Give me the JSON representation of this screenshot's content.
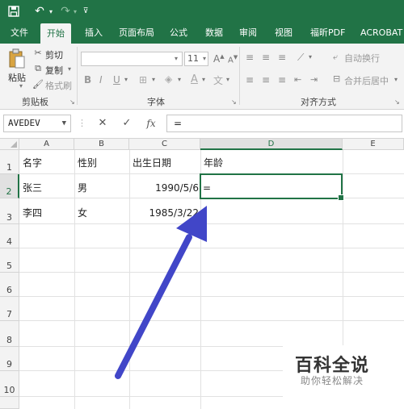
{
  "quick_access": {
    "save_icon": "save-icon",
    "undo_icon": "undo-icon",
    "redo_icon": "redo-icon",
    "customize_icon": "customize-qa-icon"
  },
  "ribbon_tabs": [
    "文件",
    "开始",
    "插入",
    "页面布局",
    "公式",
    "数据",
    "审阅",
    "视图",
    "福昕PDF",
    "ACROBAT"
  ],
  "active_tab": "开始",
  "clipboard": {
    "paste_label": "粘贴",
    "cut_label": "剪切",
    "copy_label": "复制",
    "format_painter_label": "格式刷",
    "group_label": "剪贴板"
  },
  "font_group": {
    "font_size": "11",
    "bold": "B",
    "italic": "I",
    "underline": "U",
    "group_label": "字体"
  },
  "alignment_group": {
    "wrap_text_label": "自动换行",
    "merge_center_label": "合并后居中",
    "group_label": "对齐方式"
  },
  "formula_bar": {
    "name_box": "AVEDEV",
    "cancel_symbol": "✕",
    "enter_symbol": "✓",
    "fx_label": "fx",
    "content": "="
  },
  "sheet": {
    "columns": [
      "A",
      "B",
      "C",
      "D",
      "E"
    ],
    "rows": [
      "1",
      "2",
      "3",
      "4",
      "5",
      "6",
      "7",
      "8",
      "9",
      "10"
    ],
    "active_cell": "D2",
    "cells": {
      "A1": "名字",
      "B1": "性别",
      "C1": "出生日期",
      "D1": "年龄",
      "A2": "张三",
      "B2": "男",
      "C2": "1990/5/6",
      "D2": "=",
      "A3": "李四",
      "B3": "女",
      "C3": "1985/3/22"
    }
  },
  "annotation": {
    "arrow_color": "#4146c8"
  },
  "watermark": {
    "title": "百科全说",
    "subtitle": "助你轻松解决"
  },
  "colors": {
    "excel_green": "#217346"
  }
}
